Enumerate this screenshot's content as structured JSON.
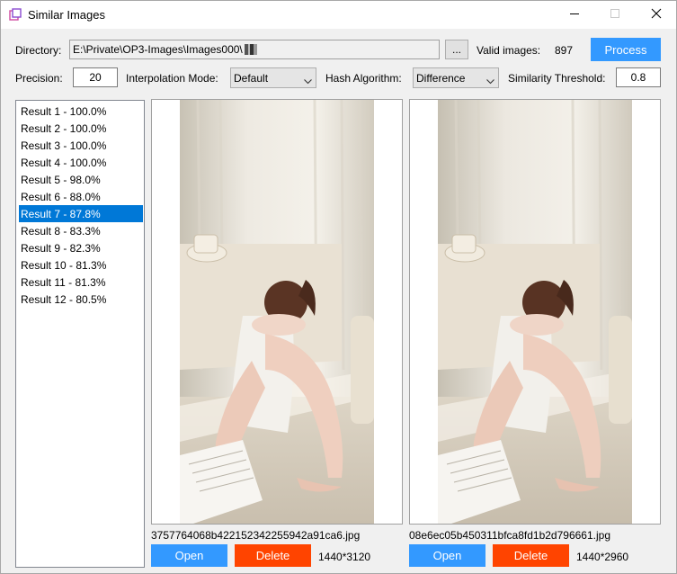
{
  "window": {
    "title": "Similar Images"
  },
  "toolbar": {
    "directory_label": "Directory:",
    "directory_value": "E:\\Private\\OP3-Images\\Images000\\",
    "browse_label": "...",
    "valid_images_label": "Valid images:",
    "valid_images_count": "897",
    "process_label": "Process",
    "precision_label": "Precision:",
    "precision_value": "20",
    "interpolation_label": "Interpolation Mode:",
    "interpolation_value": "Default",
    "hash_label": "Hash Algorithm:",
    "hash_value": "Difference",
    "threshold_label": "Similarity Threshold:",
    "threshold_value": "0.8"
  },
  "results": [
    {
      "label": "Result 1 - 100.0%"
    },
    {
      "label": "Result 2 - 100.0%"
    },
    {
      "label": "Result 3 - 100.0%"
    },
    {
      "label": "Result 4 - 100.0%"
    },
    {
      "label": "Result 5 - 98.0%"
    },
    {
      "label": "Result 6 - 88.0%"
    },
    {
      "label": "Result 7 - 87.8%",
      "selected": true
    },
    {
      "label": "Result 8 - 83.3%"
    },
    {
      "label": "Result 9 - 82.3%"
    },
    {
      "label": "Result 10 - 81.3%"
    },
    {
      "label": "Result 11 - 81.3%"
    },
    {
      "label": "Result 12 - 80.5%"
    }
  ],
  "left_image": {
    "filename": "3757764068b422152342255942a91ca6.jpg",
    "open_label": "Open",
    "delete_label": "Delete",
    "dimensions": "1440*3120"
  },
  "right_image": {
    "filename": "08e6ec05b450311bfca8fd1b2d796661.jpg",
    "open_label": "Open",
    "delete_label": "Delete",
    "dimensions": "1440*2960"
  },
  "colors": {
    "accent": "#3399ff",
    "danger": "#ff4400",
    "selection": "#0078d7"
  },
  "icons": [
    "app-icon",
    "minimize-icon",
    "maximize-icon",
    "close-icon",
    "chevron-down-icon"
  ]
}
